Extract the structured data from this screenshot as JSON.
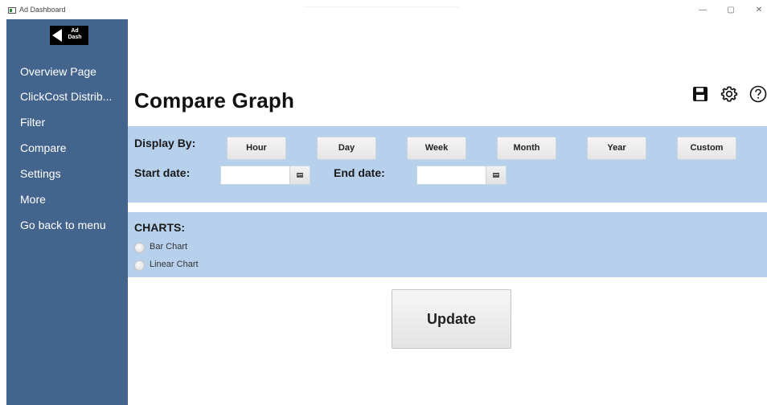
{
  "window": {
    "title": "Ad Dashboard",
    "minimize": "—",
    "maximize": "▢",
    "close": "✕"
  },
  "logo": {
    "line1": "Ad",
    "line2": "Dash"
  },
  "sidebar": {
    "items": [
      {
        "label": "Overview Page"
      },
      {
        "label": "ClickCost Distrib..."
      },
      {
        "label": "Filter"
      },
      {
        "label": "Compare"
      },
      {
        "label": "Settings"
      },
      {
        "label": "More"
      },
      {
        "label": "Go back to menu"
      }
    ]
  },
  "header": {
    "title": "Compare Graph",
    "icons": [
      "save-icon",
      "settings-gear-icon",
      "help-icon"
    ]
  },
  "display": {
    "label": "Display By:",
    "buttons": [
      "Hour",
      "Day",
      "Week",
      "Month",
      "Year",
      "Custom"
    ],
    "start_label": "Start date:",
    "end_label": "End date:",
    "start_value": "",
    "end_value": ""
  },
  "charts": {
    "label": "CHARTS:",
    "options": [
      "Bar Chart",
      "Linear Chart"
    ]
  },
  "update_label": "Update",
  "colors": {
    "sidebar": "#43648d",
    "panel": "#b7d1ec"
  }
}
